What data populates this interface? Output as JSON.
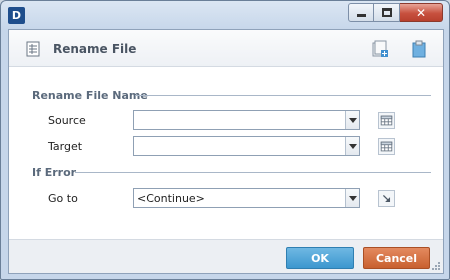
{
  "window": {
    "app_icon_text": "D",
    "close_glyph": "✕"
  },
  "header": {
    "title": "Rename File"
  },
  "rename_section": {
    "title": "Rename File Name",
    "source": {
      "label": "Source",
      "value": ""
    },
    "target": {
      "label": "Target",
      "value": ""
    }
  },
  "error_section": {
    "title": "If Error",
    "goto": {
      "label": "Go to",
      "value": "<Continue>"
    }
  },
  "footer": {
    "ok_label": "OK",
    "cancel_label": "Cancel"
  },
  "colors": {
    "ok": "#3c97cf",
    "cancel": "#c8602f",
    "close": "#c7513f"
  }
}
